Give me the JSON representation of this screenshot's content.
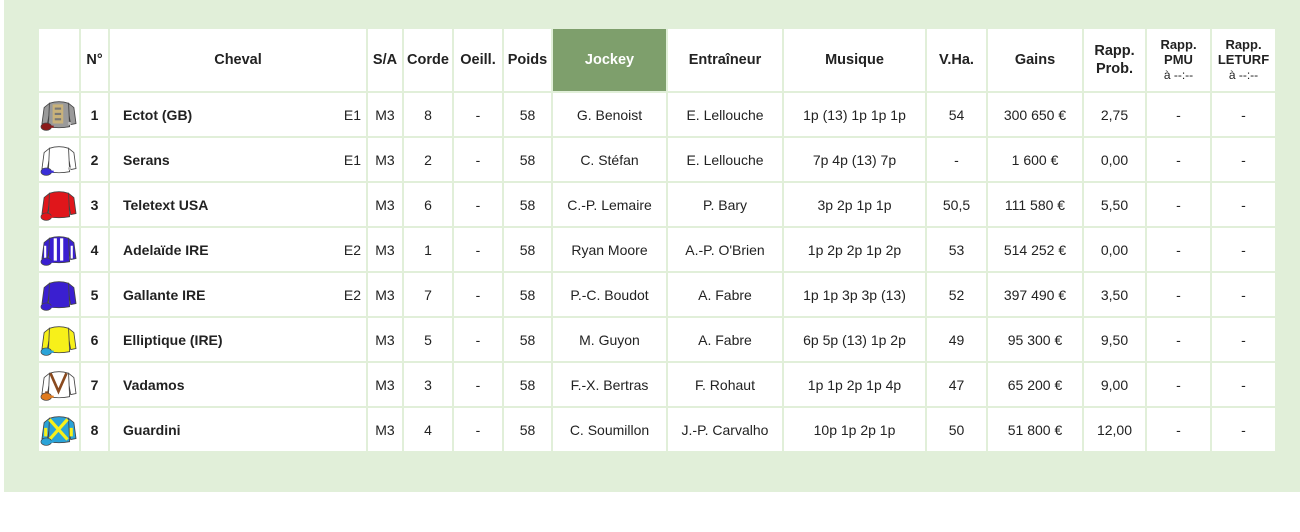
{
  "headers": {
    "silk": "",
    "num": "N°",
    "horse": "Cheval",
    "sa": "S/A",
    "corde": "Corde",
    "oeill": "Oeill.",
    "poids": "Poids",
    "jockey": "Jockey",
    "trainer": "Entraîneur",
    "musique": "Musique",
    "vha": "V.Ha.",
    "gains": "Gains",
    "rapp_prob_1": "Rapp.",
    "rapp_prob_2": "Prob.",
    "rapp_pmu_1": "Rapp.",
    "rapp_pmu_2": "PMU",
    "rapp_pmu_3": "à --:--",
    "rapp_leturf_1": "Rapp.",
    "rapp_leturf_2": "LETURF",
    "rapp_leturf_3": "à --:--"
  },
  "colors": {
    "frame_bg": "#e1efd9",
    "sorted_header_bg": "#7e9f6c"
  },
  "rows": [
    {
      "num": "1",
      "horse": "Ectot (GB)",
      "ecurie": "E1",
      "sa": "M3",
      "corde": "8",
      "oeill": "-",
      "poids": "58",
      "jockey": "G. Benoist",
      "trainer": "E. Lellouche",
      "musique": "1p (13) 1p 1p 1p",
      "vha": "54",
      "gains": "300 650 €",
      "rapp_prob": "2,75",
      "rapp_pmu": "-",
      "rapp_leturf": "-",
      "silk": {
        "icon": "grey-gold-silk-icon",
        "body": "#9a9a9a",
        "sleeve": "#9a9a9a",
        "accent": "#c9b27a",
        "cap": "#8b1a1a"
      }
    },
    {
      "num": "2",
      "horse": "Serans",
      "ecurie": "E1",
      "sa": "M3",
      "corde": "2",
      "oeill": "-",
      "poids": "58",
      "jockey": "C. Stéfan",
      "trainer": "E. Lellouche",
      "musique": "7p 4p (13) 7p",
      "vha": "-",
      "gains": "1 600 €",
      "rapp_prob": "0,00",
      "rapp_pmu": "-",
      "rapp_leturf": "-",
      "silk": {
        "icon": "white-silk-icon",
        "body": "#ffffff",
        "sleeve": "#ffffff",
        "accent": "#dddddd",
        "cap": "#3a2fd8"
      }
    },
    {
      "num": "3",
      "horse": "Teletext USA",
      "ecurie": "",
      "sa": "M3",
      "corde": "6",
      "oeill": "-",
      "poids": "58",
      "jockey": "C.-P. Lemaire",
      "trainer": "P. Bary",
      "musique": "3p 2p 1p 1p",
      "vha": "50,5",
      "gains": "111 580 €",
      "rapp_prob": "5,50",
      "rapp_pmu": "-",
      "rapp_leturf": "-",
      "silk": {
        "icon": "red-silk-icon",
        "body": "#e0161b",
        "sleeve": "#e0161b",
        "accent": "#ff5a5a",
        "cap": "#e0161b"
      }
    },
    {
      "num": "4",
      "horse": "Adelaïde IRE",
      "ecurie": "E2",
      "sa": "M3",
      "corde": "1",
      "oeill": "-",
      "poids": "58",
      "jockey": "Ryan Moore",
      "trainer": "A.-P. O'Brien",
      "musique": "1p 2p 2p 1p 2p",
      "vha": "53",
      "gains": "514 252 €",
      "rapp_prob": "0,00",
      "rapp_pmu": "-",
      "rapp_leturf": "-",
      "silk": {
        "icon": "blue-white-silk-icon",
        "body": "#3a1fd0",
        "sleeve": "#3a1fd0",
        "accent": "#ffffff",
        "cap": "#3a1fd0"
      }
    },
    {
      "num": "5",
      "horse": "Gallante IRE",
      "ecurie": "E2",
      "sa": "M3",
      "corde": "7",
      "oeill": "-",
      "poids": "58",
      "jockey": "P.-C. Boudot",
      "trainer": "A. Fabre",
      "musique": "1p 1p 3p 3p (13)",
      "vha": "52",
      "gains": "397 490 €",
      "rapp_prob": "3,50",
      "rapp_pmu": "-",
      "rapp_leturf": "-",
      "silk": {
        "icon": "blue-silk-icon",
        "body": "#3a1fd0",
        "sleeve": "#3a1fd0",
        "accent": "#3a1fd0",
        "cap": "#3a1fd0"
      }
    },
    {
      "num": "6",
      "horse": "Elliptique (IRE)",
      "ecurie": "",
      "sa": "M3",
      "corde": "5",
      "oeill": "-",
      "poids": "58",
      "jockey": "M. Guyon",
      "trainer": "A. Fabre",
      "musique": "6p 5p (13) 1p 2p",
      "vha": "49",
      "gains": "95 300 €",
      "rapp_prob": "9,50",
      "rapp_pmu": "-",
      "rapp_leturf": "-",
      "silk": {
        "icon": "yellow-silk-icon",
        "body": "#f7f01a",
        "sleeve": "#f7f01a",
        "accent": "#f7f01a",
        "cap": "#2aa3d8"
      }
    },
    {
      "num": "7",
      "horse": "Vadamos",
      "ecurie": "",
      "sa": "M3",
      "corde": "3",
      "oeill": "-",
      "poids": "58",
      "jockey": "F.-X. Bertras",
      "trainer": "F. Rohaut",
      "musique": "1p 1p 2p 1p 4p",
      "vha": "47",
      "gains": "65 200 €",
      "rapp_prob": "9,00",
      "rapp_pmu": "-",
      "rapp_leturf": "-",
      "silk": {
        "icon": "white-brown-chevron-silk-icon",
        "body": "#ffffff",
        "sleeve": "#ffffff",
        "accent": "#8a4a1f",
        "cap": "#e07a1e"
      }
    },
    {
      "num": "8",
      "horse": "Guardini",
      "ecurie": "",
      "sa": "M3",
      "corde": "4",
      "oeill": "-",
      "poids": "58",
      "jockey": "C. Soumillon",
      "trainer": "J.-P. Carvalho",
      "musique": "10p 1p 2p 1p",
      "vha": "50",
      "gains": "51 800 €",
      "rapp_prob": "12,00",
      "rapp_pmu": "-",
      "rapp_leturf": "-",
      "silk": {
        "icon": "blue-yellow-cross-silk-icon",
        "body": "#2aa3d8",
        "sleeve": "#2aa3d8",
        "accent": "#f7f01a",
        "cap": "#2aa3d8"
      }
    }
  ]
}
